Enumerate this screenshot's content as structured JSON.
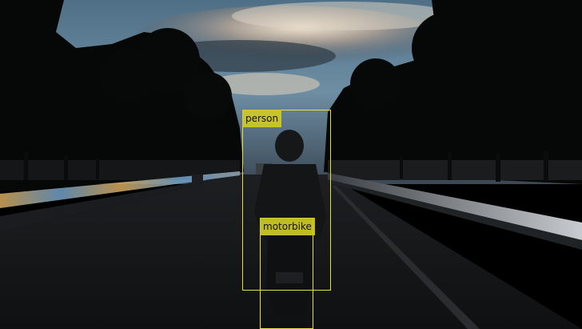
{
  "detections": [
    {
      "label": "person",
      "color": "#e5e13a"
    },
    {
      "label": "motorbike",
      "color": "#e5e13a"
    }
  ]
}
